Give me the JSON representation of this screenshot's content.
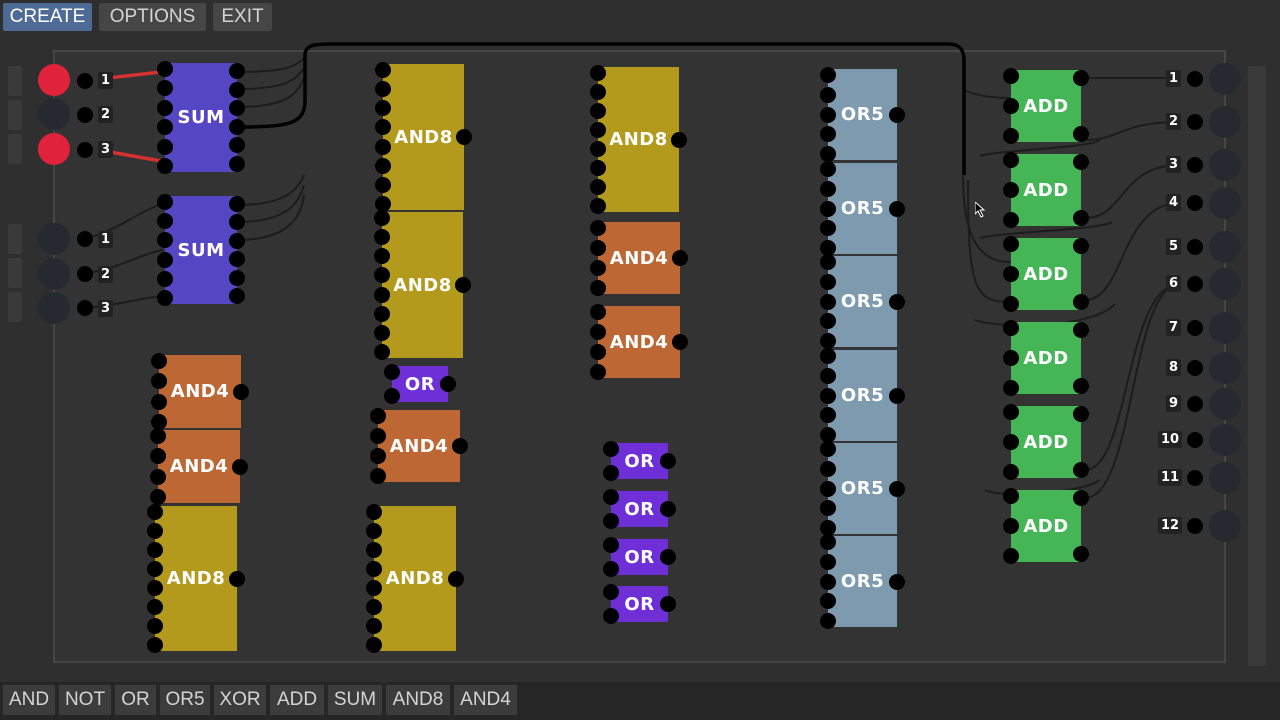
{
  "top_menu": {
    "create": "CREATE",
    "options": "OPTIONS",
    "exit": "EXIT"
  },
  "toolbar": {
    "and": "AND",
    "not": "NOT",
    "or": "OR",
    "or5": "OR5",
    "xor": "XOR",
    "add": "ADD",
    "sum": "SUM",
    "and8": "AND8",
    "and4": "AND4"
  },
  "chips": {
    "sum": "SUM",
    "and8": "AND8",
    "and4": "AND4",
    "or": "OR",
    "or5": "OR5",
    "add": "ADD"
  },
  "inputs_group_1": [
    "1",
    "2",
    "3"
  ],
  "inputs_group_2": [
    "1",
    "2",
    "3"
  ],
  "outputs": [
    "1",
    "2",
    "3",
    "4",
    "5",
    "6",
    "7",
    "8",
    "9",
    "10",
    "11",
    "12"
  ],
  "colors": {
    "sum": "#5546c4",
    "and8": "#b39a1c",
    "and4": "#bd6734",
    "or": "#6f2fd6",
    "or5": "#7d9aae",
    "add": "#44b655",
    "input_on": "#e0223a",
    "menu_active": "#4d6b95"
  }
}
